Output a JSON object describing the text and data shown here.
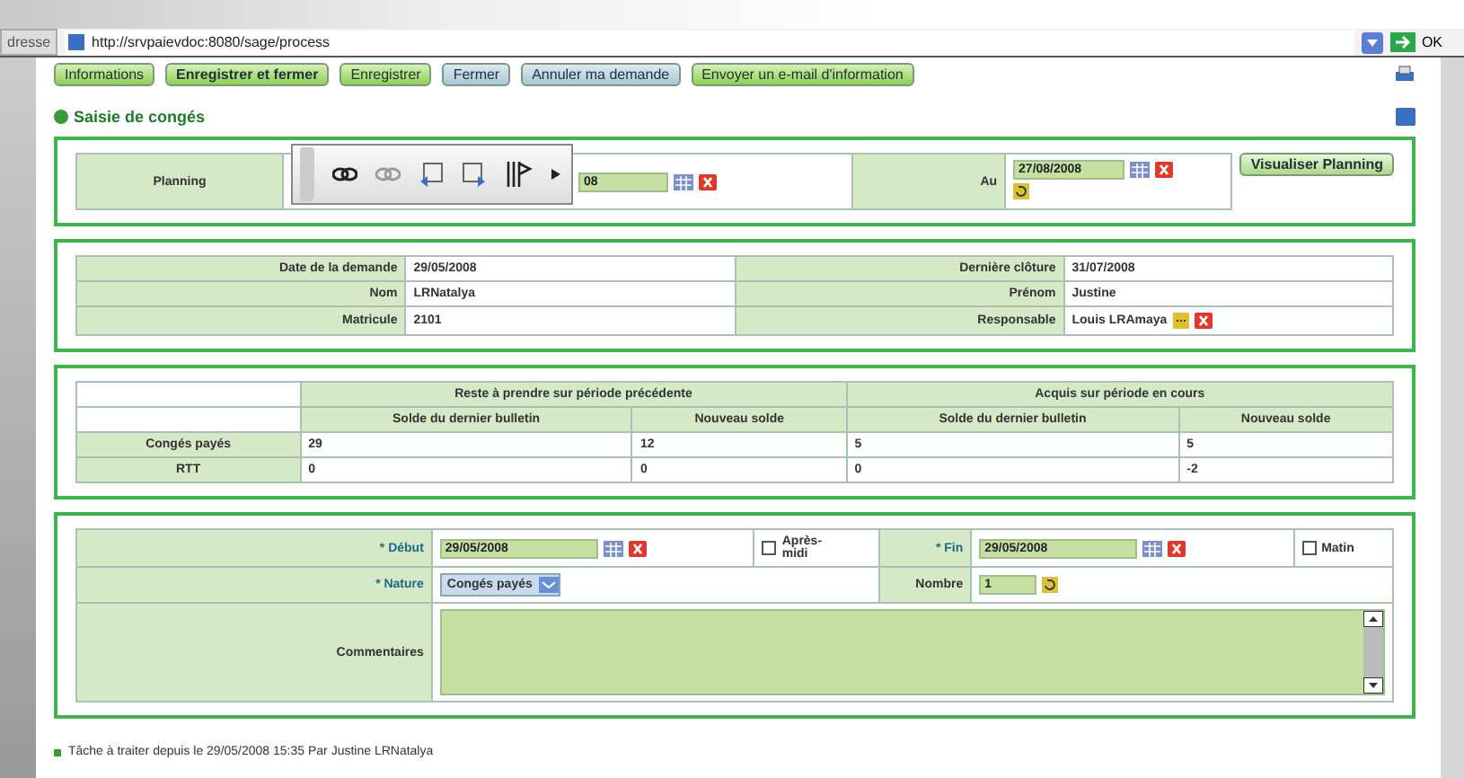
{
  "address_bar": {
    "label": "dresse",
    "url": "http://srvpaievdoc:8080/sage/process",
    "go": "OK"
  },
  "buttons": [
    {
      "label": "Informations",
      "kind": "green"
    },
    {
      "label": "Enregistrer et fermer",
      "kind": "primary"
    },
    {
      "label": "Enregistrer",
      "kind": "green"
    },
    {
      "label": "Fermer",
      "kind": "blue"
    },
    {
      "label": "Annuler ma demande",
      "kind": "blue"
    },
    {
      "label": "Envoyer un e-mail d'information",
      "kind": "green"
    }
  ],
  "section_title": "Saisie de congés",
  "planning": {
    "label": "Planning",
    "from": "08",
    "to_label": "Au",
    "to": "27/08/2008",
    "button": "Visualiser Planning"
  },
  "demande": [
    [
      {
        "label": "Date de la demande",
        "value": "29/05/2008"
      },
      {
        "label": "Dernière clôture",
        "value": "31/07/2008"
      }
    ],
    [
      {
        "label": "Nom",
        "value": "LRNatalya"
      },
      {
        "label": "Prénom",
        "value": "Justine"
      }
    ],
    [
      {
        "label": "Matricule",
        "value": "2101"
      },
      {
        "label": "Responsable",
        "value": "Louis LRAmaya",
        "kind": "picker"
      }
    ]
  ],
  "balances": {
    "groups": [
      "Reste à prendre sur période précédente",
      "Acquis sur période en cours"
    ],
    "columns": [
      "Solde du dernier bulletin",
      "Nouveau solde",
      "Solde du dernier bulletin",
      "Nouveau solde"
    ],
    "rows": [
      {
        "label": "Congés payés",
        "values": [
          "29",
          "12",
          "5",
          "5"
        ]
      },
      {
        "label": "RTT",
        "values": [
          "0",
          "0",
          "0",
          "-2"
        ]
      }
    ]
  },
  "request": {
    "debut_label": "* Début",
    "debut": "29/05/2008",
    "apres_midi": {
      "label": "Après-midi",
      "checked": false
    },
    "fin_label": "* Fin",
    "fin": "29/05/2008",
    "matin": {
      "label": "Matin",
      "checked": false
    },
    "nature_label": "* Nature",
    "nature": "Congés payés",
    "nombre_label": "Nombre",
    "nombre": "1",
    "commentaires_label": "Commentaires"
  },
  "footer": "Tâche à traiter depuis le 29/05/2008 15:35 Par Justine LRNatalya"
}
